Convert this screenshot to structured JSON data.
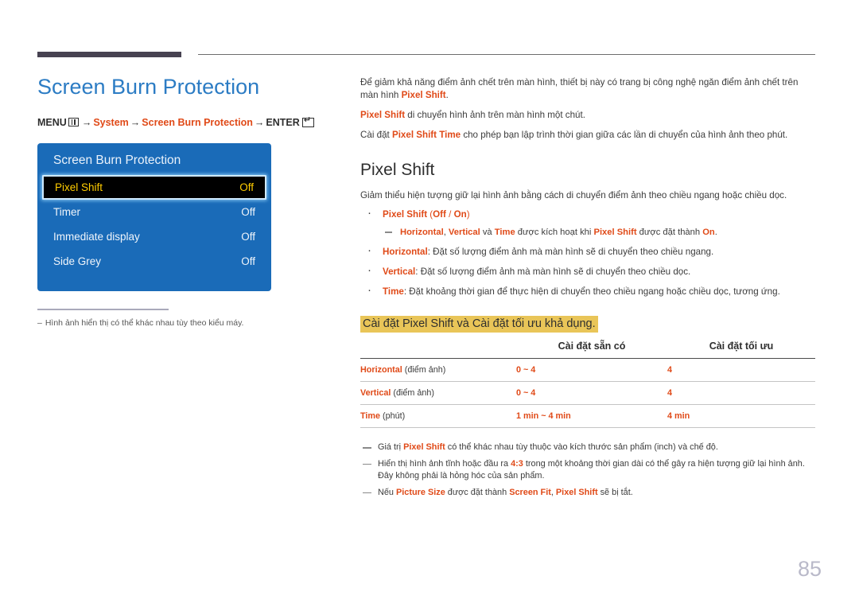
{
  "page": {
    "number": "85"
  },
  "left": {
    "title": "Screen Burn Protection",
    "breadcrumb": {
      "menu_label": "MENU",
      "menu_icon": "menu-grid-icon",
      "arrow": "→",
      "item1": "System",
      "item2": "Screen Burn Protection",
      "enter_label": "ENTER",
      "enter_icon": "enter-key-icon"
    },
    "osd": {
      "title": "Screen Burn Protection",
      "rows": [
        {
          "label": "Pixel Shift",
          "value": "Off",
          "selected": true
        },
        {
          "label": "Timer",
          "value": "Off",
          "selected": false
        },
        {
          "label": "Immediate display",
          "value": "Off",
          "selected": false
        },
        {
          "label": "Side Grey",
          "value": "Off",
          "selected": false
        }
      ]
    },
    "note": {
      "dash": "–",
      "text": "Hình ảnh hiển thị có thể khác nhau tùy theo kiểu máy."
    }
  },
  "right": {
    "intro": {
      "p1_a": "Để giảm khả năng điểm ảnh chết trên màn hình, thiết bị này có trang bị công nghệ ngăn điểm ảnh chết trên màn hình ",
      "p1_b": "Pixel Shift",
      "p1_c": ".",
      "p2_a": "Pixel Shift",
      "p2_b": " di chuyển hình ảnh trên màn hình một chút.",
      "p3_a": "Cài đặt ",
      "p3_b": "Pixel Shift Time",
      "p3_c": " cho phép bạn lập trình thời gian giữa các lần di chuyển của hình ảnh theo phút."
    },
    "section_title": "Pixel Shift",
    "lead": "Giảm thiểu hiện tượng giữ lại hình ảnh bằng cách di chuyển điểm ảnh theo chiều ngang hoặc chiều dọc.",
    "bullets": [
      {
        "name_a": "Pixel Shift",
        "rest_plain": " (",
        "opt1": "Off",
        "sep": " / ",
        "opt2": "On",
        "tail": ")",
        "subnote": {
          "t1": "Horizontal",
          "t1b": ", ",
          "t2": "Vertical",
          "t2b": " và ",
          "t3": "Time",
          "t3b": " được kích hoạt khi ",
          "t4": "Pixel Shift",
          "t4b": " được đặt thành ",
          "t5": "On",
          "t5b": "."
        }
      },
      {
        "name_a": "Horizontal",
        "rest_plain": ": Đặt số lượng điểm ảnh mà màn hình sẽ di chuyển theo chiều ngang."
      },
      {
        "name_a": "Vertical",
        "rest_plain": ": Đặt số lượng điểm ảnh mà màn hình sẽ di chuyển theo chiều dọc."
      },
      {
        "name_a": "Time",
        "rest_plain": ": Đặt khoảng thời gian để thực hiện di chuyển theo chiều ngang hoặc chiều dọc, tương ứng."
      }
    ],
    "highlight_heading": "Cài đặt Pixel Shift và Cài đặt tối ưu khả dụng.",
    "table": {
      "headers": [
        "",
        "Cài đặt sẵn có",
        "Cài đặt tối ưu"
      ],
      "rows": [
        {
          "key_accent": "Horizontal",
          "key_plain": " (điểm ảnh)",
          "available": "0 ~ 4",
          "optimum": "4"
        },
        {
          "key_accent": "Vertical",
          "key_plain": " (điểm ảnh)",
          "available": "0 ~ 4",
          "optimum": "4"
        },
        {
          "key_accent": "Time",
          "key_plain": " (phút)",
          "available": "1 min ~ 4 min",
          "optimum": "4 min"
        }
      ]
    },
    "footnotes": [
      {
        "a": "Giá trị ",
        "b": "Pixel Shift",
        "c": " có thể khác nhau tùy thuộc vào kích thước sản phẩm (inch) và chế độ."
      },
      {
        "a": "Hiển thị hình ảnh tĩnh hoặc đầu ra ",
        "b": "4:3",
        "c": " trong một khoảng thời gian dài có thể gây ra hiện tượng giữ lại hình ảnh. Đây không phải là hỏng hóc của sản phẩm."
      },
      {
        "a": "Nếu ",
        "b": "Picture Size",
        "c": " được đặt thành ",
        "d": "Screen Fit",
        "e": ", ",
        "f": "Pixel Shift",
        "g": " sẽ bị tắt."
      }
    ]
  },
  "colors": {
    "title_blue": "#2c7cc4",
    "accent_orange": "#e04a18",
    "osd_blue": "#1a6bb8",
    "osd_selected_text": "#ffcc00",
    "highlight_gold": "#e9c558",
    "rule_dark": "#474251",
    "page_num_gray": "#b9b9c9"
  }
}
